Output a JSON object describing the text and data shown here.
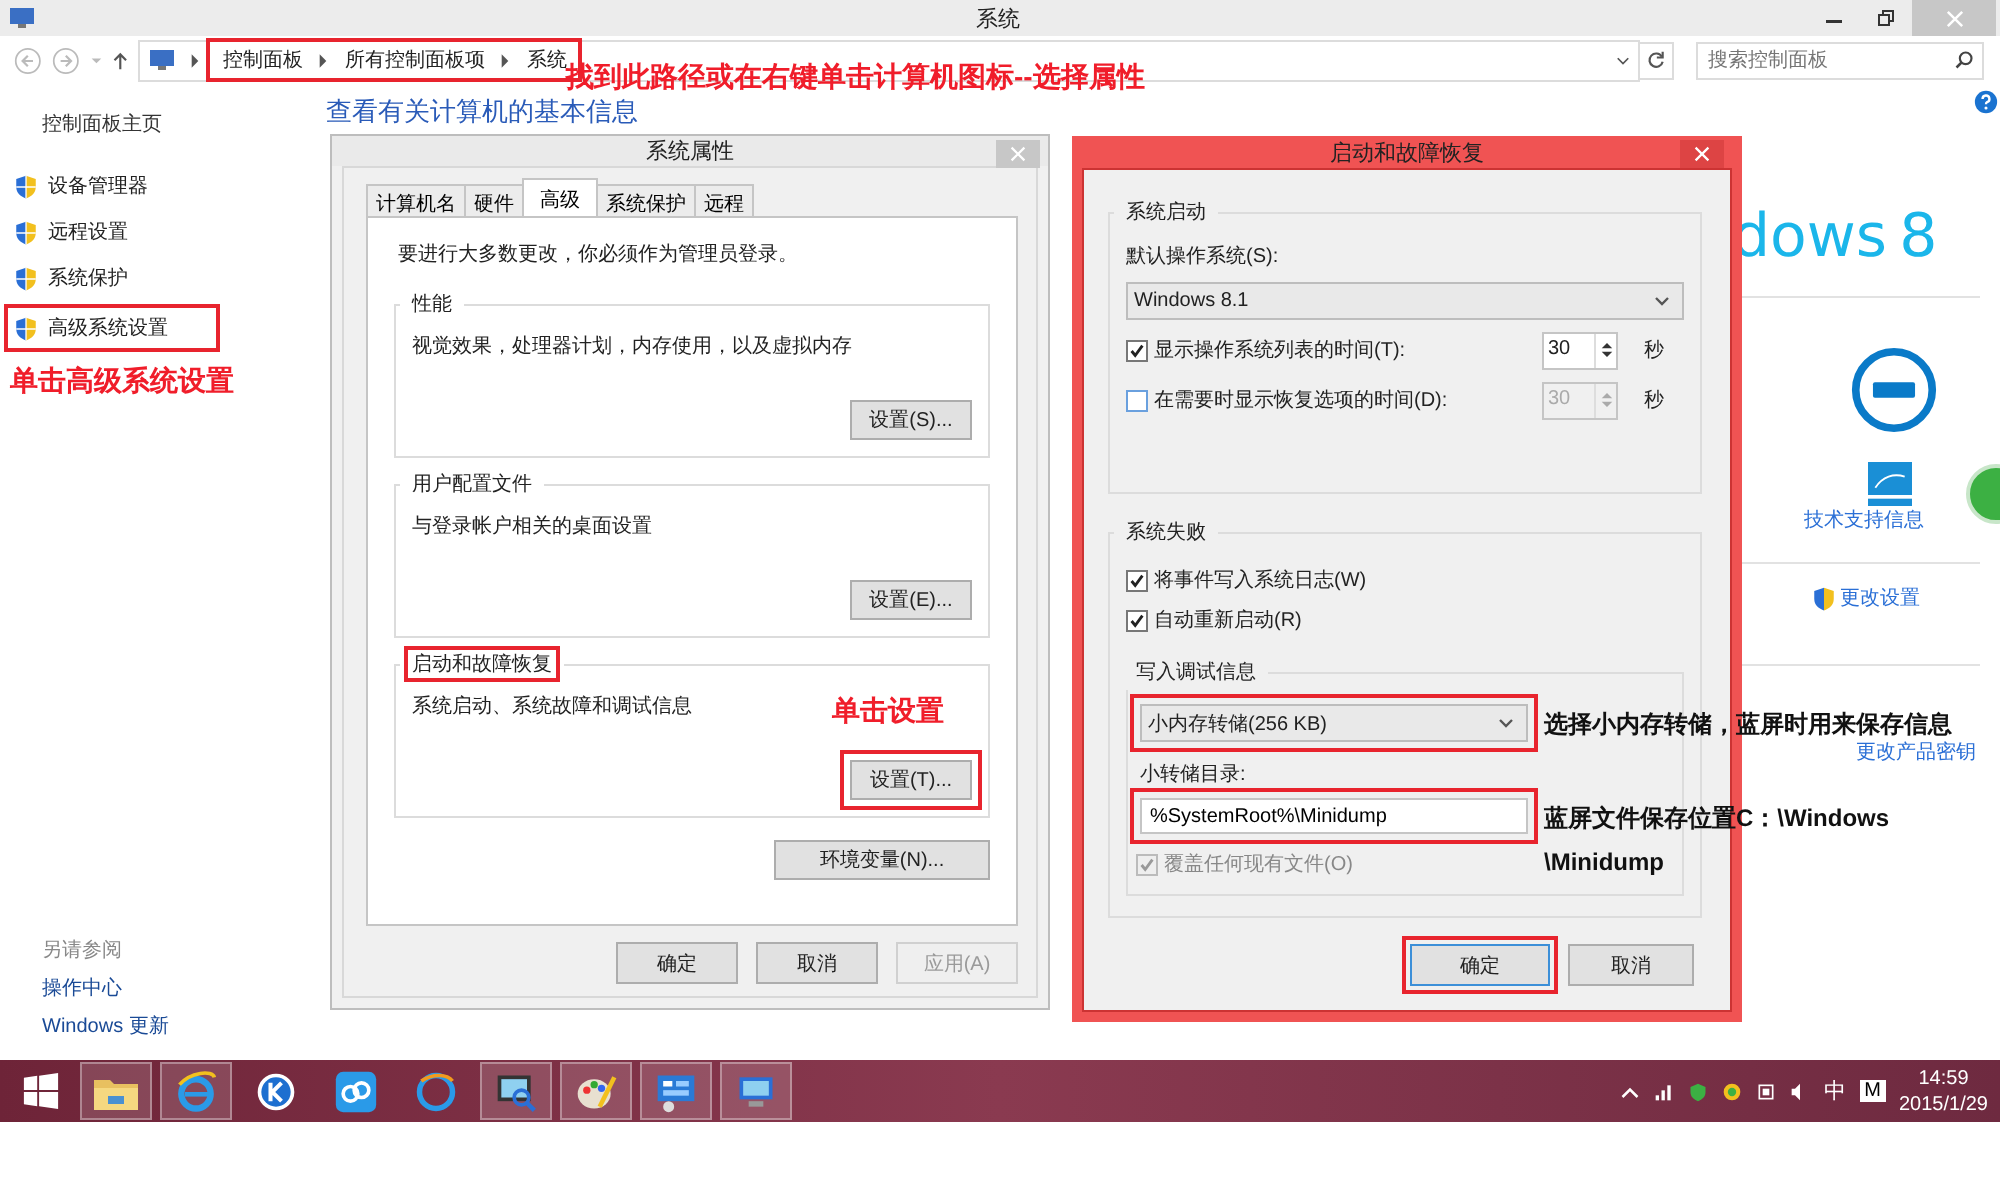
{
  "explorer": {
    "title": "系统",
    "breadcrumb": [
      {
        "label": "控制面板"
      },
      {
        "label": "所有控制面板项"
      },
      {
        "label": "系统"
      }
    ],
    "breadcrumb_highlighted": true,
    "search": {
      "placeholder": "搜索控制面板"
    }
  },
  "sidebar": {
    "home": "控制面板主页",
    "items": [
      {
        "label": "设备管理器",
        "highlighted": false
      },
      {
        "label": "远程设置",
        "highlighted": false
      },
      {
        "label": "系统保护",
        "highlighted": false
      },
      {
        "label": "高级系统设置",
        "highlighted": true
      }
    ],
    "see_also_title": "另请参阅",
    "see_also": [
      "操作中心",
      "Windows 更新"
    ]
  },
  "main": {
    "heading": "查看有关计算机的基本信息",
    "logo_text": "dows",
    "logo_version": "8",
    "support_link": "技术支持信息",
    "change_settings": "更改设置",
    "change_key": "更改产品密钥"
  },
  "system_properties": {
    "title": "系统属性",
    "tabs": [
      {
        "label": "计算机名",
        "selected": false
      },
      {
        "label": "硬件",
        "selected": false
      },
      {
        "label": "高级",
        "selected": true
      },
      {
        "label": "系统保护",
        "selected": false
      },
      {
        "label": "远程",
        "selected": false
      }
    ],
    "admin_note": "要进行大多数更改，你必须作为管理员登录。",
    "groups": [
      {
        "title": "性能",
        "description": "视觉效果，处理器计划，内存使用，以及虚拟内存",
        "button": "设置(S)...",
        "highlighted": false
      },
      {
        "title": "用户配置文件",
        "description": "与登录帐户相关的桌面设置",
        "button": "设置(E)...",
        "highlighted": false
      },
      {
        "title": "启动和故障恢复",
        "description": "系统启动、系统故障和调试信息",
        "button": "设置(T)...",
        "highlighted": true
      }
    ],
    "env_button": "环境变量(N)...",
    "buttons": [
      {
        "label": "确定",
        "disabled": false
      },
      {
        "label": "取消",
        "disabled": false
      },
      {
        "label": "应用(A)",
        "disabled": true
      }
    ]
  },
  "startup_recovery": {
    "title": "启动和故障恢复",
    "startup_group": "系统启动",
    "default_os_label": "默认操作系统(S):",
    "default_os": "Windows 8.1",
    "timers": [
      {
        "label": "显示操作系统列表的时间(T):",
        "checked": true,
        "value": "30",
        "unit": "秒",
        "disabled": false
      },
      {
        "label": "在需要时显示恢复选项的时间(D):",
        "checked": false,
        "value": "30",
        "unit": "秒",
        "disabled": true
      }
    ],
    "failure_group": "系统失败",
    "failure_options": [
      {
        "label": "将事件写入系统日志(W)",
        "checked": true
      },
      {
        "label": "自动重新启动(R)",
        "checked": true
      }
    ],
    "debug_group": "写入调试信息",
    "debug_type": "小内存转储(256 KB)",
    "debug_type_highlighted": true,
    "dump_dir_label": "小转储目录:",
    "dump_dir": "%SystemRoot%\\Minidump",
    "dump_dir_highlighted": true,
    "overwrite": {
      "label": "覆盖任何现有文件(O)",
      "checked": true,
      "disabled": true
    },
    "buttons": [
      {
        "label": "确定",
        "highlighted": true
      },
      {
        "label": "取消",
        "highlighted": false
      }
    ]
  },
  "annotations": {
    "path_hint": "找到此路径或在右键单击计算机图标--选择属性",
    "sidebar_hint": "单击高级系统设置",
    "settings_hint": "单击设置",
    "dump_type_hint": "选择小内存转储，蓝屏时用来保存信息",
    "dump_dir_hint": "蓝屏文件保存位置C：\\Windows\n\\Minidump"
  },
  "taskbar": {
    "apps": [
      {
        "kind": "folder",
        "running": true
      },
      {
        "kind": "ie",
        "running": true
      },
      {
        "kind": "k",
        "running": false
      },
      {
        "kind": "cloud",
        "running": false
      },
      {
        "kind": "browser",
        "running": false
      },
      {
        "kind": "monitor",
        "running": true
      },
      {
        "kind": "paint",
        "running": true
      },
      {
        "kind": "panel",
        "running": true
      },
      {
        "kind": "computer",
        "running": true
      }
    ],
    "ime": "中",
    "ime_mode": "M",
    "time": "14:59",
    "date": "2015/1/29"
  }
}
